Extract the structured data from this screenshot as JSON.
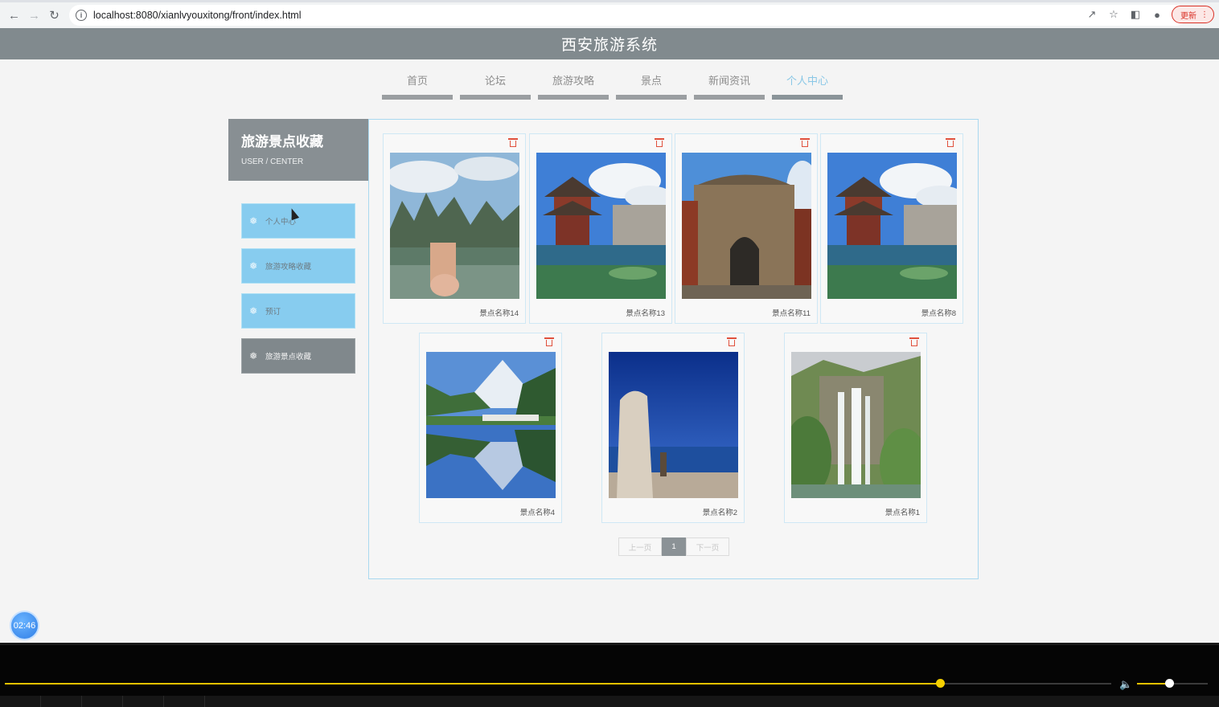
{
  "browser": {
    "url": "localhost:8080/xianlvyouxitong/front/index.html",
    "update_label": "更新"
  },
  "site": {
    "title": "西安旅游系统"
  },
  "nav": [
    {
      "label": "首页",
      "active": false
    },
    {
      "label": "论坛",
      "active": false
    },
    {
      "label": "旅游攻略",
      "active": false
    },
    {
      "label": "景点",
      "active": false
    },
    {
      "label": "新闻资讯",
      "active": false
    },
    {
      "label": "个人中心",
      "active": true
    }
  ],
  "sidebar": {
    "title": "旅游景点收藏",
    "subtitle": "USER / CENTER",
    "items": [
      {
        "label": "个人中心",
        "active": false
      },
      {
        "label": "旅游攻略收藏",
        "active": false
      },
      {
        "label": "预订",
        "active": false
      },
      {
        "label": "旅游景点收藏",
        "active": true
      }
    ]
  },
  "favorites": [
    {
      "name": "景点名称14",
      "scene": "karst-river"
    },
    {
      "name": "景点名称13",
      "scene": "pagoda-lake"
    },
    {
      "name": "景点名称11",
      "scene": "city-gate"
    },
    {
      "name": "景点名称8",
      "scene": "pagoda-lake"
    },
    {
      "name": "景点名称4",
      "scene": "bridge-reflection"
    },
    {
      "name": "景点名称2",
      "scene": "lake-stone"
    },
    {
      "name": "景点名称1",
      "scene": "waterfall"
    }
  ],
  "pagination": {
    "prev": "上一页",
    "current": "1",
    "next": "下一页"
  },
  "timer": "02:46",
  "player": {
    "seek_progress": 0.845,
    "volume": 0.45
  },
  "colors": {
    "accent": "#87ccef",
    "header": "#818a8e",
    "active": "#80888c",
    "delete": "#e0503c",
    "seek": "#e8c200"
  }
}
